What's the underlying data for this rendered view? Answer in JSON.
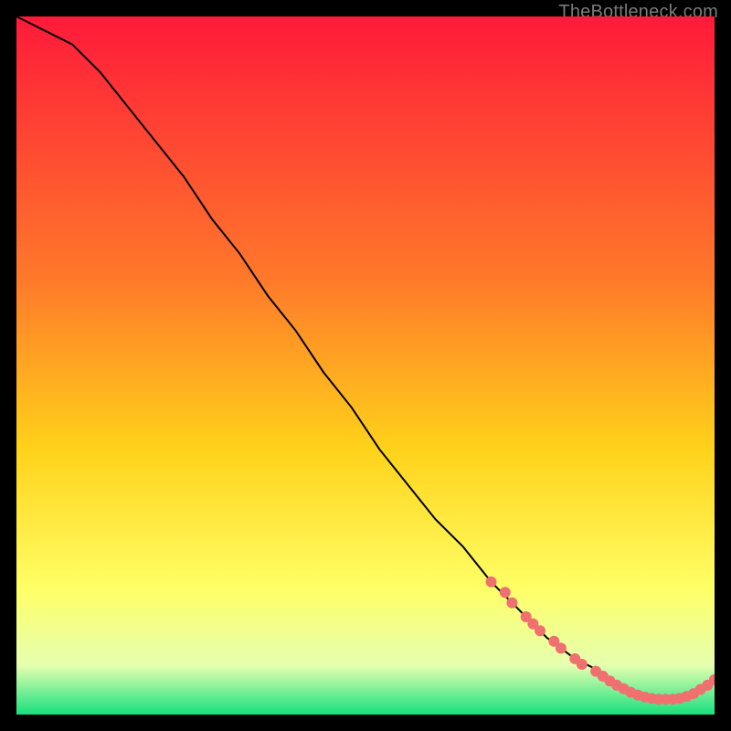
{
  "watermark": "TheBottleneck.com",
  "colors": {
    "top": "#ff1a3a",
    "mid1": "#ff7a2a",
    "mid2": "#ffd21a",
    "mid3": "#ffff66",
    "mid4": "#e5ffb0",
    "bottom": "#17e07e",
    "curve": "#000000",
    "marker": "#f07070"
  },
  "chart_data": {
    "type": "line",
    "title": "",
    "xlabel": "",
    "ylabel": "",
    "xlim": [
      0,
      100
    ],
    "ylim": [
      0,
      100
    ],
    "grid": false,
    "legend": false,
    "series": [
      {
        "name": "curve",
        "x": [
          0,
          4,
          8,
          12,
          16,
          20,
          24,
          28,
          32,
          36,
          40,
          44,
          48,
          52,
          56,
          60,
          64,
          68,
          72,
          76,
          80,
          84,
          86,
          88,
          90,
          92,
          94,
          96,
          98,
          100
        ],
        "y": [
          100,
          98,
          96,
          92,
          87,
          82,
          77,
          71,
          66,
          60,
          55,
          49,
          44,
          38,
          33,
          28,
          24,
          19,
          15,
          11,
          8,
          6,
          4,
          3,
          2.5,
          2.2,
          2.2,
          2.5,
          3.5,
          5
        ]
      }
    ],
    "markers": [
      {
        "x": 68,
        "y": 19
      },
      {
        "x": 70,
        "y": 17.5
      },
      {
        "x": 71,
        "y": 16
      },
      {
        "x": 73,
        "y": 14
      },
      {
        "x": 74,
        "y": 13
      },
      {
        "x": 75,
        "y": 12
      },
      {
        "x": 77,
        "y": 10.5
      },
      {
        "x": 78,
        "y": 9.5
      },
      {
        "x": 80,
        "y": 8
      },
      {
        "x": 81,
        "y": 7.2
      },
      {
        "x": 83,
        "y": 6.2
      },
      {
        "x": 84,
        "y": 5.5
      },
      {
        "x": 85,
        "y": 4.8
      },
      {
        "x": 86,
        "y": 4.2
      },
      {
        "x": 87,
        "y": 3.7
      },
      {
        "x": 88,
        "y": 3.2
      },
      {
        "x": 89,
        "y": 2.8
      },
      {
        "x": 90,
        "y": 2.5
      },
      {
        "x": 91,
        "y": 2.3
      },
      {
        "x": 92,
        "y": 2.2
      },
      {
        "x": 93,
        "y": 2.2
      },
      {
        "x": 94,
        "y": 2.2
      },
      {
        "x": 95,
        "y": 2.3
      },
      {
        "x": 96,
        "y": 2.6
      },
      {
        "x": 97,
        "y": 3.0
      },
      {
        "x": 98,
        "y": 3.6
      },
      {
        "x": 99,
        "y": 4.2
      },
      {
        "x": 100,
        "y": 5.0
      }
    ]
  }
}
